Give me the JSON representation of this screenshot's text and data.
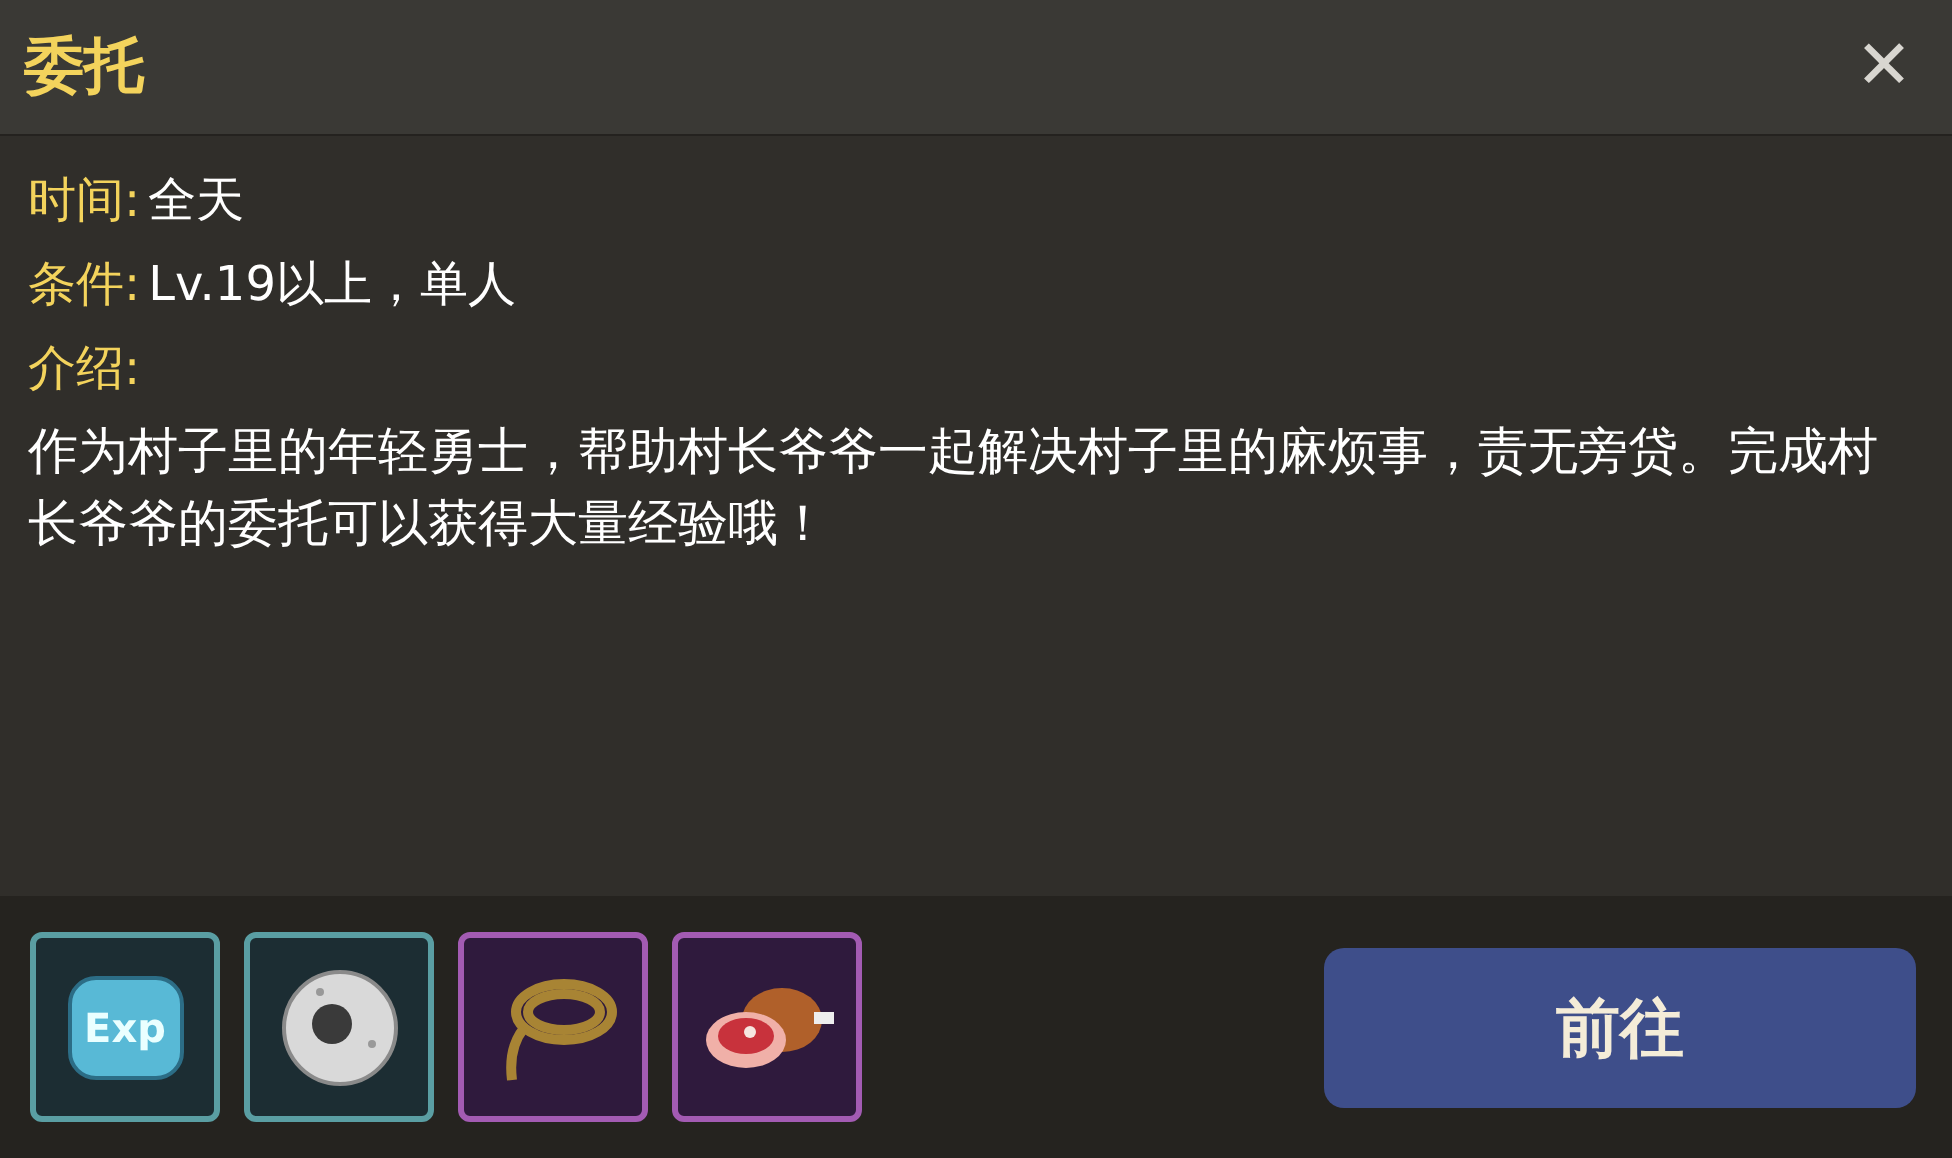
{
  "window": {
    "title": "委托",
    "close": "✕"
  },
  "fields": [
    {
      "label": "时间:",
      "value": "全天"
    },
    {
      "label": "条件:",
      "value": "Lv.19以上，单人"
    },
    {
      "label": "介绍:"
    }
  ],
  "description": "作为村子里的年轻勇士，帮助村长爷爷一起解决村子里的麻烦事，责无旁贷。完成村长爷爷的委托可以获得大量经验哦！",
  "rewards": [
    {
      "kind": "exp",
      "label": "Exp",
      "color": "#5a9ea3"
    },
    {
      "kind": "ring",
      "color": "#5a9ea3"
    },
    {
      "kind": "rope",
      "color": "#a35bb3"
    },
    {
      "kind": "meat",
      "color": "#a35bb3"
    }
  ],
  "go_button": "前往"
}
